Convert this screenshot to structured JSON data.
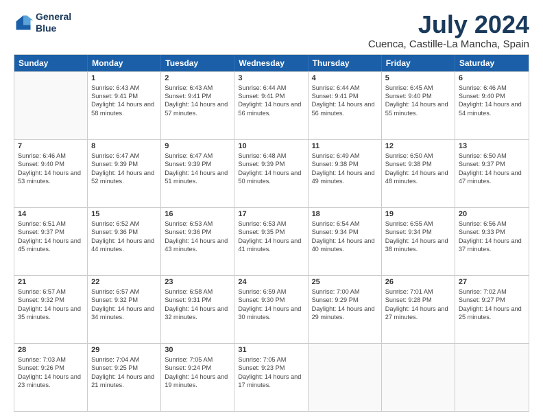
{
  "logo": {
    "line1": "General",
    "line2": "Blue"
  },
  "title": "July 2024",
  "subtitle": "Cuenca, Castille-La Mancha, Spain",
  "days": [
    "Sunday",
    "Monday",
    "Tuesday",
    "Wednesday",
    "Thursday",
    "Friday",
    "Saturday"
  ],
  "weeks": [
    [
      {
        "day": "",
        "sunrise": "",
        "sunset": "",
        "daylight": ""
      },
      {
        "day": "1",
        "sunrise": "Sunrise: 6:43 AM",
        "sunset": "Sunset: 9:41 PM",
        "daylight": "Daylight: 14 hours and 58 minutes."
      },
      {
        "day": "2",
        "sunrise": "Sunrise: 6:43 AM",
        "sunset": "Sunset: 9:41 PM",
        "daylight": "Daylight: 14 hours and 57 minutes."
      },
      {
        "day": "3",
        "sunrise": "Sunrise: 6:44 AM",
        "sunset": "Sunset: 9:41 PM",
        "daylight": "Daylight: 14 hours and 56 minutes."
      },
      {
        "day": "4",
        "sunrise": "Sunrise: 6:44 AM",
        "sunset": "Sunset: 9:41 PM",
        "daylight": "Daylight: 14 hours and 56 minutes."
      },
      {
        "day": "5",
        "sunrise": "Sunrise: 6:45 AM",
        "sunset": "Sunset: 9:40 PM",
        "daylight": "Daylight: 14 hours and 55 minutes."
      },
      {
        "day": "6",
        "sunrise": "Sunrise: 6:46 AM",
        "sunset": "Sunset: 9:40 PM",
        "daylight": "Daylight: 14 hours and 54 minutes."
      }
    ],
    [
      {
        "day": "7",
        "sunrise": "Sunrise: 6:46 AM",
        "sunset": "Sunset: 9:40 PM",
        "daylight": "Daylight: 14 hours and 53 minutes."
      },
      {
        "day": "8",
        "sunrise": "Sunrise: 6:47 AM",
        "sunset": "Sunset: 9:39 PM",
        "daylight": "Daylight: 14 hours and 52 minutes."
      },
      {
        "day": "9",
        "sunrise": "Sunrise: 6:47 AM",
        "sunset": "Sunset: 9:39 PM",
        "daylight": "Daylight: 14 hours and 51 minutes."
      },
      {
        "day": "10",
        "sunrise": "Sunrise: 6:48 AM",
        "sunset": "Sunset: 9:39 PM",
        "daylight": "Daylight: 14 hours and 50 minutes."
      },
      {
        "day": "11",
        "sunrise": "Sunrise: 6:49 AM",
        "sunset": "Sunset: 9:38 PM",
        "daylight": "Daylight: 14 hours and 49 minutes."
      },
      {
        "day": "12",
        "sunrise": "Sunrise: 6:50 AM",
        "sunset": "Sunset: 9:38 PM",
        "daylight": "Daylight: 14 hours and 48 minutes."
      },
      {
        "day": "13",
        "sunrise": "Sunrise: 6:50 AM",
        "sunset": "Sunset: 9:37 PM",
        "daylight": "Daylight: 14 hours and 47 minutes."
      }
    ],
    [
      {
        "day": "14",
        "sunrise": "Sunrise: 6:51 AM",
        "sunset": "Sunset: 9:37 PM",
        "daylight": "Daylight: 14 hours and 45 minutes."
      },
      {
        "day": "15",
        "sunrise": "Sunrise: 6:52 AM",
        "sunset": "Sunset: 9:36 PM",
        "daylight": "Daylight: 14 hours and 44 minutes."
      },
      {
        "day": "16",
        "sunrise": "Sunrise: 6:53 AM",
        "sunset": "Sunset: 9:36 PM",
        "daylight": "Daylight: 14 hours and 43 minutes."
      },
      {
        "day": "17",
        "sunrise": "Sunrise: 6:53 AM",
        "sunset": "Sunset: 9:35 PM",
        "daylight": "Daylight: 14 hours and 41 minutes."
      },
      {
        "day": "18",
        "sunrise": "Sunrise: 6:54 AM",
        "sunset": "Sunset: 9:34 PM",
        "daylight": "Daylight: 14 hours and 40 minutes."
      },
      {
        "day": "19",
        "sunrise": "Sunrise: 6:55 AM",
        "sunset": "Sunset: 9:34 PM",
        "daylight": "Daylight: 14 hours and 38 minutes."
      },
      {
        "day": "20",
        "sunrise": "Sunrise: 6:56 AM",
        "sunset": "Sunset: 9:33 PM",
        "daylight": "Daylight: 14 hours and 37 minutes."
      }
    ],
    [
      {
        "day": "21",
        "sunrise": "Sunrise: 6:57 AM",
        "sunset": "Sunset: 9:32 PM",
        "daylight": "Daylight: 14 hours and 35 minutes."
      },
      {
        "day": "22",
        "sunrise": "Sunrise: 6:57 AM",
        "sunset": "Sunset: 9:32 PM",
        "daylight": "Daylight: 14 hours and 34 minutes."
      },
      {
        "day": "23",
        "sunrise": "Sunrise: 6:58 AM",
        "sunset": "Sunset: 9:31 PM",
        "daylight": "Daylight: 14 hours and 32 minutes."
      },
      {
        "day": "24",
        "sunrise": "Sunrise: 6:59 AM",
        "sunset": "Sunset: 9:30 PM",
        "daylight": "Daylight: 14 hours and 30 minutes."
      },
      {
        "day": "25",
        "sunrise": "Sunrise: 7:00 AM",
        "sunset": "Sunset: 9:29 PM",
        "daylight": "Daylight: 14 hours and 29 minutes."
      },
      {
        "day": "26",
        "sunrise": "Sunrise: 7:01 AM",
        "sunset": "Sunset: 9:28 PM",
        "daylight": "Daylight: 14 hours and 27 minutes."
      },
      {
        "day": "27",
        "sunrise": "Sunrise: 7:02 AM",
        "sunset": "Sunset: 9:27 PM",
        "daylight": "Daylight: 14 hours and 25 minutes."
      }
    ],
    [
      {
        "day": "28",
        "sunrise": "Sunrise: 7:03 AM",
        "sunset": "Sunset: 9:26 PM",
        "daylight": "Daylight: 14 hours and 23 minutes."
      },
      {
        "day": "29",
        "sunrise": "Sunrise: 7:04 AM",
        "sunset": "Sunset: 9:25 PM",
        "daylight": "Daylight: 14 hours and 21 minutes."
      },
      {
        "day": "30",
        "sunrise": "Sunrise: 7:05 AM",
        "sunset": "Sunset: 9:24 PM",
        "daylight": "Daylight: 14 hours and 19 minutes."
      },
      {
        "day": "31",
        "sunrise": "Sunrise: 7:05 AM",
        "sunset": "Sunset: 9:23 PM",
        "daylight": "Daylight: 14 hours and 17 minutes."
      },
      {
        "day": "",
        "sunrise": "",
        "sunset": "",
        "daylight": ""
      },
      {
        "day": "",
        "sunrise": "",
        "sunset": "",
        "daylight": ""
      },
      {
        "day": "",
        "sunrise": "",
        "sunset": "",
        "daylight": ""
      }
    ]
  ]
}
